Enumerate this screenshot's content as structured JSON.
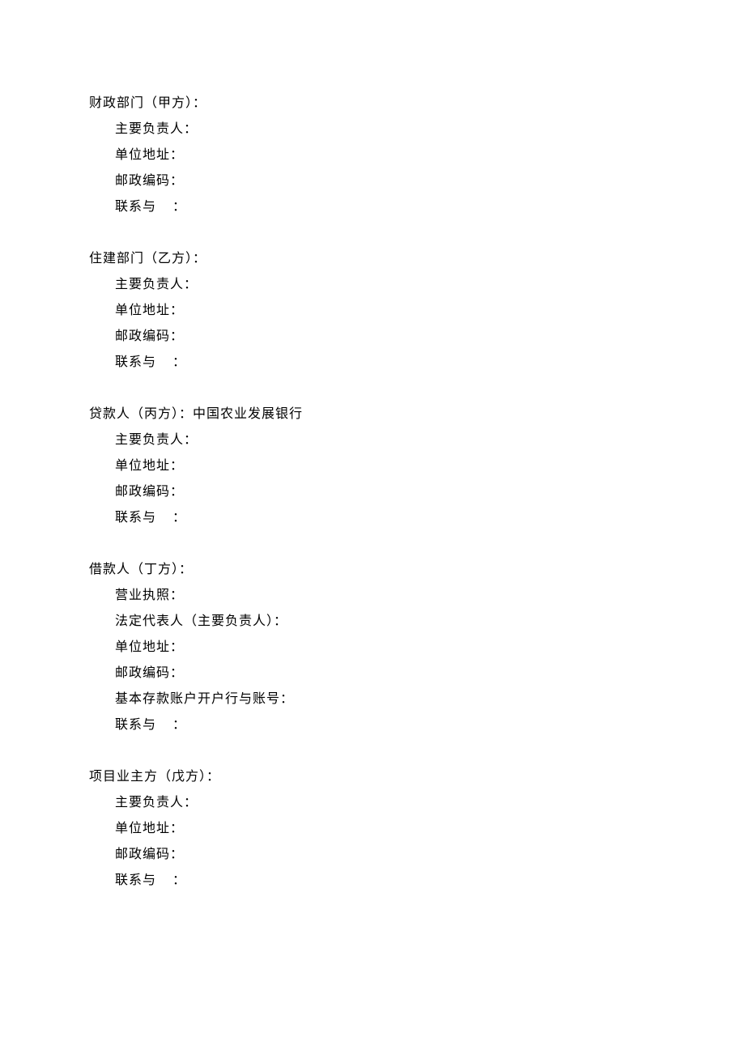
{
  "parties": {
    "a": {
      "header_prefix": "财政部门（甲方）",
      "responsible_label": "主要负责人",
      "address_label": "单位地址",
      "postal_label": "邮政编码",
      "contact_prefix": "联系与",
      "contact_suffix": "："
    },
    "b": {
      "header_prefix": "住建部门（乙方）",
      "responsible_label": "主要负责人",
      "address_label": "单位地址",
      "postal_label": "邮政编码",
      "contact_prefix": "联系与",
      "contact_suffix": "："
    },
    "c": {
      "header_prefix": "贷款人（丙方）：中国农业发展银行",
      "responsible_label": "主要负责人",
      "address_label": "单位地址",
      "postal_label": "邮政编码",
      "contact_prefix": "联系与",
      "contact_suffix": "："
    },
    "d": {
      "header_prefix": "借款人（丁方）",
      "license_label": "营业执照",
      "legal_label": "法定代表人（主要负责人）",
      "address_label": "单位地址",
      "postal_label": "邮政编码",
      "bank_label": "基本存款账户开户行与账号",
      "contact_prefix": "联系与",
      "contact_suffix": "："
    },
    "e": {
      "header_prefix": "项目业主方（戊方）",
      "responsible_label": "主要负责人",
      "address_label": "单位地址",
      "postal_label": "邮政编码",
      "contact_prefix": "联系与",
      "contact_suffix": "："
    }
  },
  "colon": "："
}
